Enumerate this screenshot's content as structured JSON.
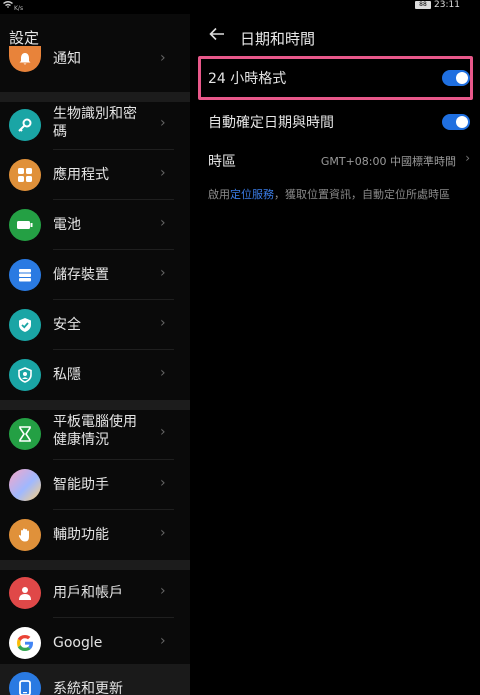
{
  "status": {
    "speed": "K/s",
    "battery": "88",
    "time": "23:11"
  },
  "left": {
    "title": "設定",
    "items": [
      {
        "label": "通知"
      },
      {
        "label": "生物識別和密\n碼"
      },
      {
        "label": "應用程式"
      },
      {
        "label": "電池"
      },
      {
        "label": "儲存裝置"
      },
      {
        "label": "安全"
      },
      {
        "label": "私隱"
      },
      {
        "label": "平板電腦使用\n健康情況"
      },
      {
        "label": "智能助手"
      },
      {
        "label": "輔助功能"
      },
      {
        "label": "用戶和帳戶"
      },
      {
        "label": "Google"
      },
      {
        "label": "系統和更新"
      }
    ]
  },
  "right": {
    "title": "日期和時間",
    "rows": {
      "format24": "24 小時格式",
      "auto_datetime": "自動確定日期與時間",
      "timezone_label": "時區",
      "timezone_value": "GMT+08:00 中國標準時間"
    },
    "hint": {
      "prefix": "啟用",
      "link": "定位服務",
      "suffix": "，獲取位置資訊，自動定位所處時區"
    },
    "toggles": {
      "format24": true,
      "auto_datetime": true
    }
  },
  "colors": {
    "accent": "#1f6fe0",
    "highlight": "#e8588a",
    "link": "#3b7de8"
  }
}
